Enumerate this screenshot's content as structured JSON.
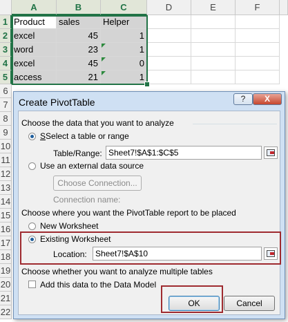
{
  "spreadsheet": {
    "columns": [
      "A",
      "B",
      "C",
      "D",
      "E",
      "F"
    ],
    "rows": [
      "1",
      "2",
      "3",
      "4",
      "5",
      "6",
      "7",
      "8",
      "9",
      "10",
      "11",
      "12",
      "13",
      "14",
      "15",
      "16",
      "17",
      "18",
      "19",
      "20",
      "21",
      "22"
    ],
    "header_row": [
      "Product",
      "sales",
      "Helper"
    ],
    "data_rows": [
      [
        "excel",
        "45",
        "1"
      ],
      [
        "word",
        "23",
        "1"
      ],
      [
        "excel",
        "45",
        "0"
      ],
      [
        "access",
        "21",
        "1"
      ]
    ]
  },
  "dialog": {
    "title": "Create PivotTable",
    "help_button": "?",
    "close_button": "X",
    "section_analyze": "Choose the data that you want to analyze",
    "option_select_table": "Select a table or range",
    "table_range_label": "Table/Range:",
    "table_range_value": "Sheet7!$A$1:$C$5",
    "option_external": "Use an external data source",
    "choose_connection_button": "Choose Connection...",
    "connection_name_label": "Connection name:",
    "section_place": "Choose where you want the PivotTable report to be placed",
    "option_new_worksheet": "New Worksheet",
    "option_existing_worksheet": "Existing Worksheet",
    "location_label": "Location:",
    "location_value": "Sheet7!$A$10",
    "section_multiple": "Choose whether you want to analyze multiple tables",
    "data_model_checkbox": "Add this data to the Data Model",
    "ok_button": "OK",
    "cancel_button": "Cancel"
  },
  "colors": {
    "selection_border": "#217346",
    "highlight_box": "#9e2a2f",
    "dialog_frame": "#cfe0f3"
  }
}
